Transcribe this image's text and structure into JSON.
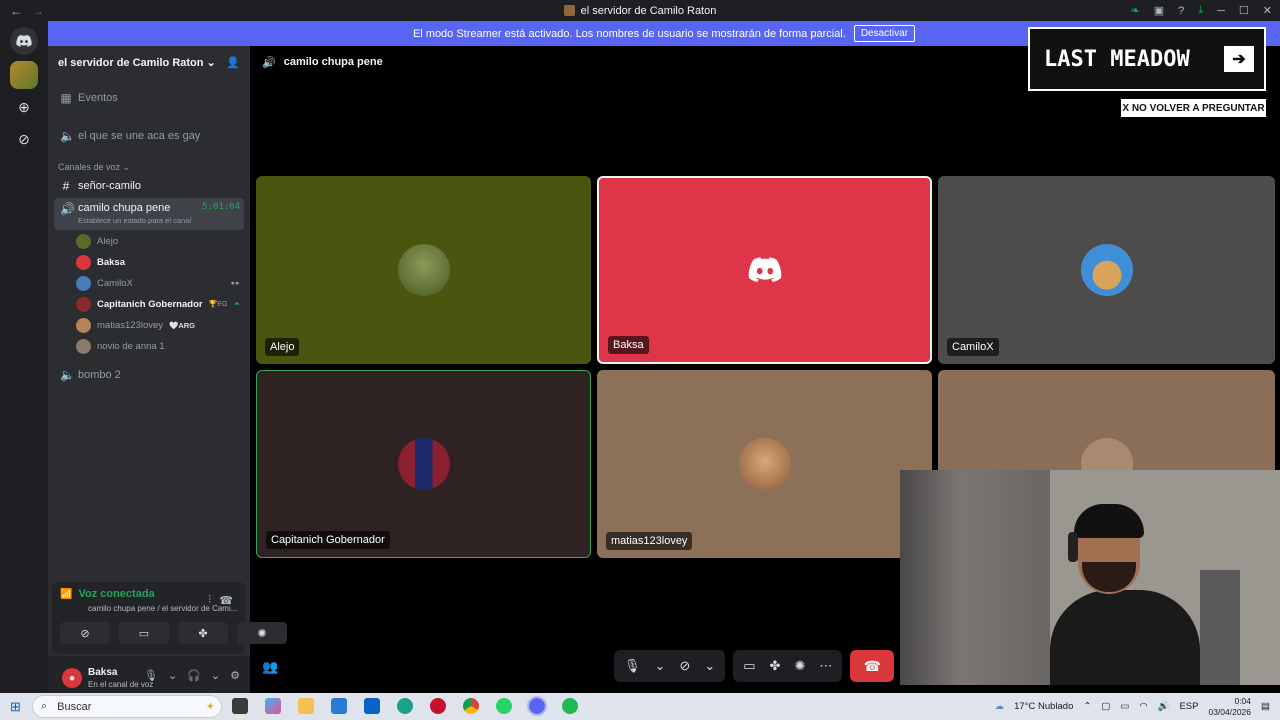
{
  "window": {
    "title": "el servidor de Camilo Raton"
  },
  "streamer_bar": {
    "message": "El modo Streamer está activado. Los nombres de usuario se mostrarán de forma parcial.",
    "button": "Desactivar"
  },
  "server": {
    "name": "el servidor de Camilo Raton",
    "events_label": "Eventos",
    "channels": [
      {
        "name": "el que se une aca es gay",
        "type": "voice"
      }
    ],
    "category": "Canales de voz",
    "text_channel": "señor-camilo",
    "active_voice": {
      "name": "camilo chupa pene",
      "timer": "5:01:04",
      "status_hint": "Establece un estado para el canal"
    },
    "members": [
      {
        "name": "Alejo",
        "color": "#5b6a2a"
      },
      {
        "name": "Baksa",
        "color": "#da373c"
      },
      {
        "name": "CamiloX",
        "color": "#4a7bb8"
      },
      {
        "name": "Capitanich Gobernador",
        "color": "#8a2a2a",
        "extra": "🏆EG"
      },
      {
        "name": "matias123lovey",
        "color": "#b7845a",
        "extra": "🤍ARG"
      },
      {
        "name": "novio de anna 1",
        "color": "#8a7a6a"
      }
    ],
    "other_voice": "bombo 2"
  },
  "voice_panel": {
    "title": "Voz conectada",
    "subtitle": "camilo chupa pene / el servidor de Cami..."
  },
  "user": {
    "name": "Baksa",
    "status": "En el canal de voz"
  },
  "stage": {
    "channel": "camilo chupa pene",
    "tiles": [
      {
        "name": "Alejo",
        "bg": "#4a5510",
        "avatar": "#6a7a3a"
      },
      {
        "name": "Baksa",
        "bg": "#df3549",
        "avatar": "discord"
      },
      {
        "name": "CamiloX",
        "bg": "#4d4c4a",
        "avatar": "#3f8fd8"
      },
      {
        "name": "Capitanich Gobernador",
        "bg": "#2e2222",
        "avatar": "#8a2030"
      },
      {
        "name": "matias123lovey",
        "bg": "#8d7058",
        "avatar": "#c99a6a"
      },
      {
        "name": "",
        "bg": "#8a6e58",
        "avatar": "#a88a70"
      }
    ]
  },
  "ad": {
    "text": "LAST MEADOW",
    "dismiss": "X NO VOLVER A PREGUNTAR"
  },
  "taskbar": {
    "search": "Buscar",
    "weather": "17°C  Nublado",
    "lang": "ESP",
    "time": "0:04",
    "date": "03/04/2026"
  }
}
